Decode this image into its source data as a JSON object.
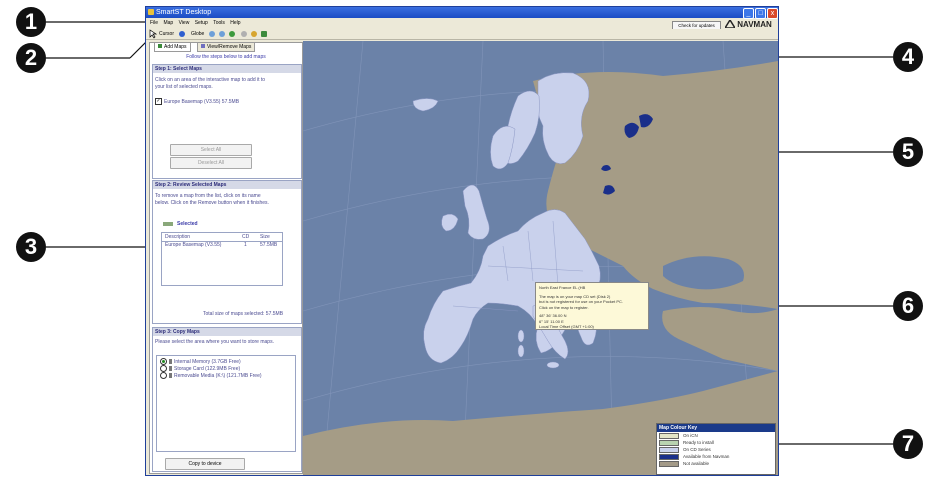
{
  "callouts": [
    "1",
    "2",
    "3",
    "4",
    "5",
    "6",
    "7"
  ],
  "window": {
    "title": "SmartST Desktop",
    "minimize": "_",
    "maximize": "□",
    "close": "x"
  },
  "menu": [
    "File",
    "Map",
    "View",
    "Setup",
    "Tools",
    "Help"
  ],
  "toolbar": {
    "cursor": "Cursor",
    "globe": "Globe"
  },
  "check_updates": "Check for updates",
  "logo": "NAVMAN",
  "tabs": [
    "Add Maps",
    "View/Remove Maps"
  ],
  "panel_subtitle": "Follow the steps below to add maps",
  "step1": {
    "title": "Step 1: Select Maps",
    "instructions": "Click on an area of the interactive map to add it to your list of selected maps.",
    "item": "Europe Basemap (V3.55) 57.5MB",
    "select_all": "Select All",
    "deselect_all": "Deselect All"
  },
  "step2": {
    "title": "Step 2: Review Selected Maps",
    "instructions": "To remove a map from the list, click on its name below. Click on the Remove button when it finishes.",
    "legend": "Selected",
    "columns": [
      "Description",
      "CD",
      "Size"
    ],
    "rows": [
      [
        "Europe Basemap (V3.55)",
        "1",
        "57.5MB"
      ]
    ],
    "total": "Total size of maps selected: 57.5MB"
  },
  "step3": {
    "title": "Step 3: Copy Maps",
    "instructions": "Please select the area where you want to store maps.",
    "options": [
      "Internal Memory (3.7GB Free)",
      "Storage Card (122.9MB Free)",
      "Removable Media (K:\\) (121.7MB Free)"
    ],
    "copy_button": "Copy to device"
  },
  "tooltip": {
    "lines": [
      "North East France    EL (HB",
      "",
      "The map is on your map CD set (Disk 2)",
      "but is not registered for use on your Pocket PC.",
      "Click on the map to register.",
      "",
      "48° 36' 36.00 N",
      "6° 15' 11.00 E",
      "Local Time Offset (GMT +1:00)"
    ]
  },
  "key": {
    "title": "Map Colour Key",
    "items": [
      {
        "label": "On iCN",
        "color": "#e3e6c8"
      },
      {
        "label": "Ready to install",
        "color": "#b9d3b0"
      },
      {
        "label": "On CD Series",
        "color": "#c9d1ec"
      },
      {
        "label": "Available from Navman",
        "color": "#1a2f8a"
      },
      {
        "label": "Not available",
        "color": "#a39a88"
      }
    ]
  }
}
